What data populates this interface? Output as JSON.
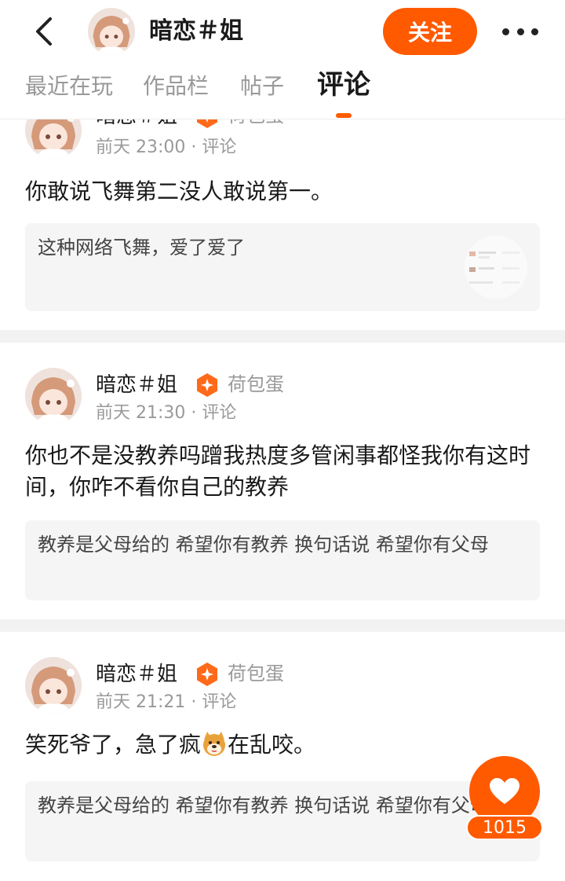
{
  "header": {
    "title": "暗恋＃姐",
    "follow_label": "关注"
  },
  "tabs": [
    {
      "label": "最近在玩"
    },
    {
      "label": "作品栏"
    },
    {
      "label": "帖子"
    },
    {
      "label": "评论",
      "active": true
    }
  ],
  "comments": [
    {
      "user": "暗恋＃姐",
      "badge": "荷包蛋",
      "time": "前天 23:00",
      "type": "评论",
      "text": "你敢说飞舞第二没人敢说第一。",
      "quote": "这种网络飞舞，爱了爱了",
      "quote_has_image": true
    },
    {
      "user": "暗恋＃姐",
      "badge": "荷包蛋",
      "time": "前天 21:30",
      "type": "评论",
      "text": "你也不是没教养吗蹭我热度多管闲事都怪我你有这时间，你咋不看你自己的教养",
      "quote": "教养是父母给的 希望你有教养 换句话说 希望你有父母"
    },
    {
      "user": "暗恋＃姐",
      "badge": "荷包蛋",
      "time": "前天 21:21",
      "type": "评论",
      "text_before_emoji": "笑死爷了，急了疯",
      "emoji": "dog-face",
      "text_after_emoji": "在乱咬。",
      "quote": "教养是父母给的 希望你有教养 换句话说 希望你有父母"
    }
  ],
  "like": {
    "count": "1015"
  },
  "colors": {
    "accent": "#ff5a00",
    "muted_text": "#999999",
    "quote_bg": "#f5f5f5"
  }
}
